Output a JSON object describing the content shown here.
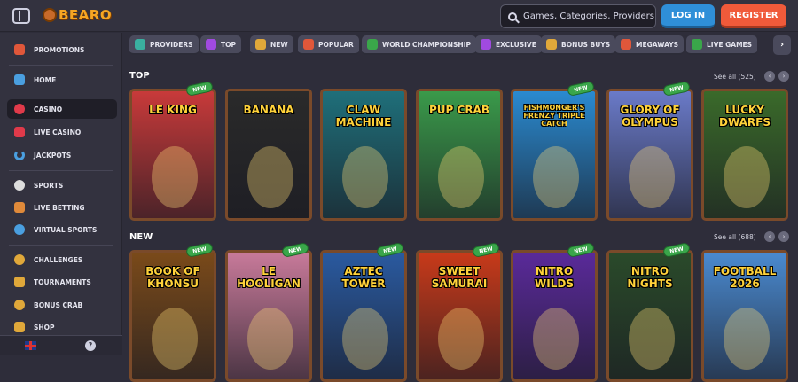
{
  "header": {
    "logo": "BEARO",
    "search_placeholder": "Games, Categories, Providers",
    "login": "LOG IN",
    "register": "REGISTER"
  },
  "sidebar": {
    "items": [
      {
        "label": "PROMOTIONS",
        "icon": "gift-icon",
        "color": "#e0573a"
      },
      {
        "label": "HOME",
        "icon": "home-icon",
        "color": "#4a9fe0"
      },
      {
        "label": "CASINO",
        "icon": "cherry-icon",
        "color": "#e03a4a"
      },
      {
        "label": "LIVE CASINO",
        "icon": "cards-icon",
        "color": "#e03a4a"
      },
      {
        "label": "JACKPOTS",
        "icon": "horseshoe-icon",
        "color": "#4a9fe0"
      },
      {
        "label": "SPORTS",
        "icon": "soccer-ball-icon",
        "color": "#dddddd"
      },
      {
        "label": "LIVE BETTING",
        "icon": "live-icon",
        "color": "#e08a3a"
      },
      {
        "label": "VIRTUAL SPORTS",
        "icon": "globe-icon",
        "color": "#4a9fe0"
      },
      {
        "label": "CHALLENGES",
        "icon": "target-icon",
        "color": "#e0a83a"
      },
      {
        "label": "TOURNAMENTS",
        "icon": "trophy-icon",
        "color": "#e0a83a"
      },
      {
        "label": "BONUS CRAB",
        "icon": "crab-icon",
        "color": "#e0a83a"
      },
      {
        "label": "SHOP",
        "icon": "shop-icon",
        "color": "#e0a83a"
      }
    ]
  },
  "categories": [
    {
      "label": "PROVIDERS",
      "icon": "providers-icon",
      "color": "#3ab0a0"
    },
    {
      "label": "TOP",
      "icon": "star-icon",
      "color": "#a04ae0"
    },
    {
      "label": "NEW",
      "icon": "lightning-icon",
      "color": "#e0a83a"
    },
    {
      "label": "POPULAR",
      "icon": "fire-icon",
      "color": "#e0573a"
    },
    {
      "label": "WORLD CHAMPIONSHIP",
      "icon": "trophy-icon",
      "color": "#3aa64a"
    },
    {
      "label": "EXCLUSIVE",
      "icon": "diamond-icon",
      "color": "#a04ae0"
    },
    {
      "label": "BONUS BUYS",
      "icon": "gift-icon",
      "color": "#e0a83a"
    },
    {
      "label": "MEGAWAYS",
      "icon": "megaways-icon",
      "color": "#e0573a"
    },
    {
      "label": "LIVE GAMES",
      "icon": "live-icon",
      "color": "#3aa64a"
    }
  ],
  "sections": {
    "top": {
      "title": "TOP",
      "see_all": "See all (525)",
      "games": [
        {
          "title": "LE KING",
          "bg": "#c83a3a",
          "new": true
        },
        {
          "title": "BANANA",
          "bg": "#2a2a2a",
          "new": false
        },
        {
          "title": "CLAW MACHINE",
          "bg": "#1f6f7a",
          "new": false
        },
        {
          "title": "PUP CRAB",
          "bg": "#3a9a4a",
          "new": false
        },
        {
          "title": "FISHMONGER'S FRENZY TRIPLE CATCH",
          "bg": "#2a8ad0",
          "new": true
        },
        {
          "title": "GLORY OF OLYMPUS",
          "bg": "#6a7ac8",
          "new": true
        },
        {
          "title": "LUCKY DWARFS",
          "bg": "#3a6a2a",
          "new": false
        }
      ]
    },
    "new": {
      "title": "NEW",
      "see_all": "See all (688)",
      "games": [
        {
          "title": "BOOK OF KHONSU",
          "bg": "#7a4a1a",
          "new": true
        },
        {
          "title": "LE HOOLIGAN",
          "bg": "#c87a9a",
          "new": true
        },
        {
          "title": "AZTEC TOWER",
          "bg": "#2a5aa0",
          "new": true
        },
        {
          "title": "SWEET SAMURAI",
          "bg": "#c83a1a",
          "new": true
        },
        {
          "title": "NITRO WILDS",
          "bg": "#5a2a9a",
          "new": true
        },
        {
          "title": "NITRO NIGHTS",
          "bg": "#2a4a2a",
          "new": true
        },
        {
          "title": "FOOTBALL 2026",
          "bg": "#4a8ad0",
          "new": false
        }
      ]
    }
  },
  "badge_label": "NEW",
  "footer": {
    "help": "?"
  }
}
